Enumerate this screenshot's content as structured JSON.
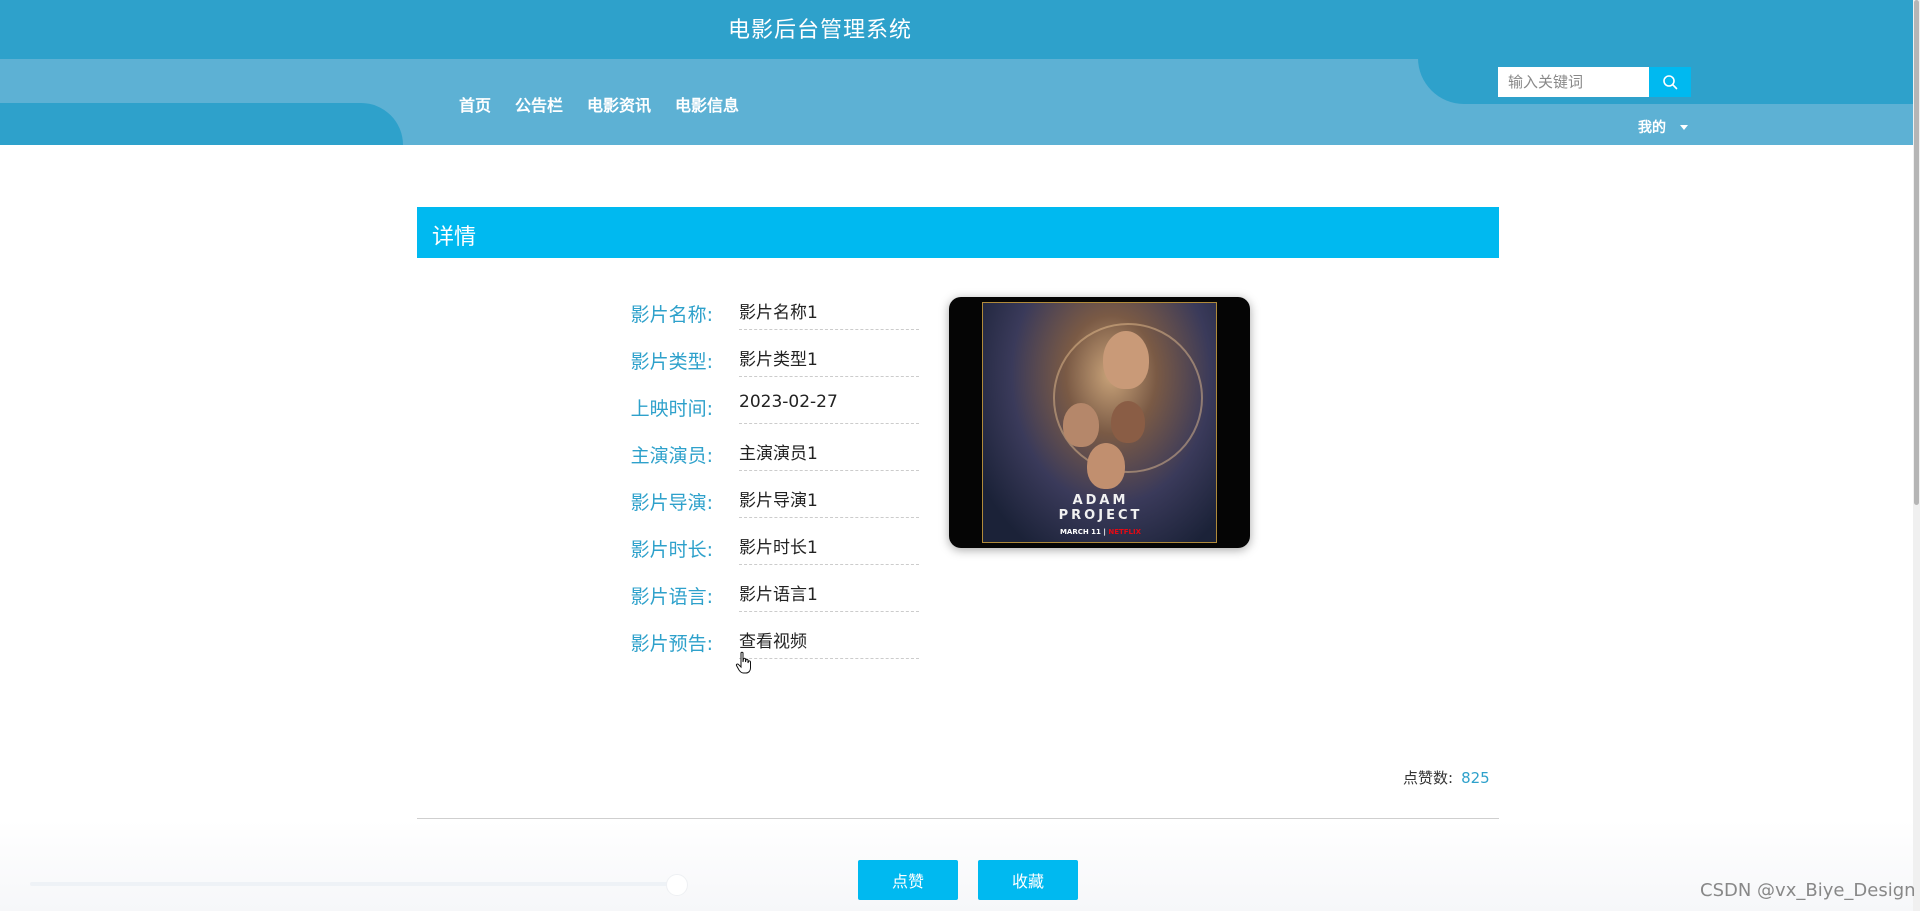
{
  "header": {
    "site_title": "电影后台管理系统",
    "nav": [
      "首页",
      "公告栏",
      "电影资讯",
      "电影信息"
    ],
    "search_placeholder": "输入关键词",
    "mine_label": "我的"
  },
  "detail": {
    "section_title": "详情",
    "fields": [
      {
        "label": "影片名称:",
        "value": "影片名称1"
      },
      {
        "label": "影片类型:",
        "value": "影片类型1"
      },
      {
        "label": "上映时间:",
        "value": "2023-02-27"
      },
      {
        "label": "主演演员:",
        "value": "主演演员1"
      },
      {
        "label": "影片导演:",
        "value": "影片导演1"
      },
      {
        "label": "影片时长:",
        "value": "影片时长1"
      },
      {
        "label": "影片语言:",
        "value": "影片语言1"
      },
      {
        "label": "影片预告:",
        "value": "查看视频"
      }
    ],
    "poster": {
      "title_line1": "ADAM",
      "title_line2": "PROJECT",
      "date_text": "MARCH 11",
      "brand": "NETFLIX"
    },
    "likes_label": "点赞数:",
    "likes_count": "825"
  },
  "actions": {
    "like_label": "点赞",
    "favorite_label": "收藏"
  },
  "watermark": "CSDN @vx_Biye_Design",
  "colors": {
    "header_dark": "#2ea1cb",
    "header_light": "#5db1d4",
    "accent": "#00b9f0"
  }
}
